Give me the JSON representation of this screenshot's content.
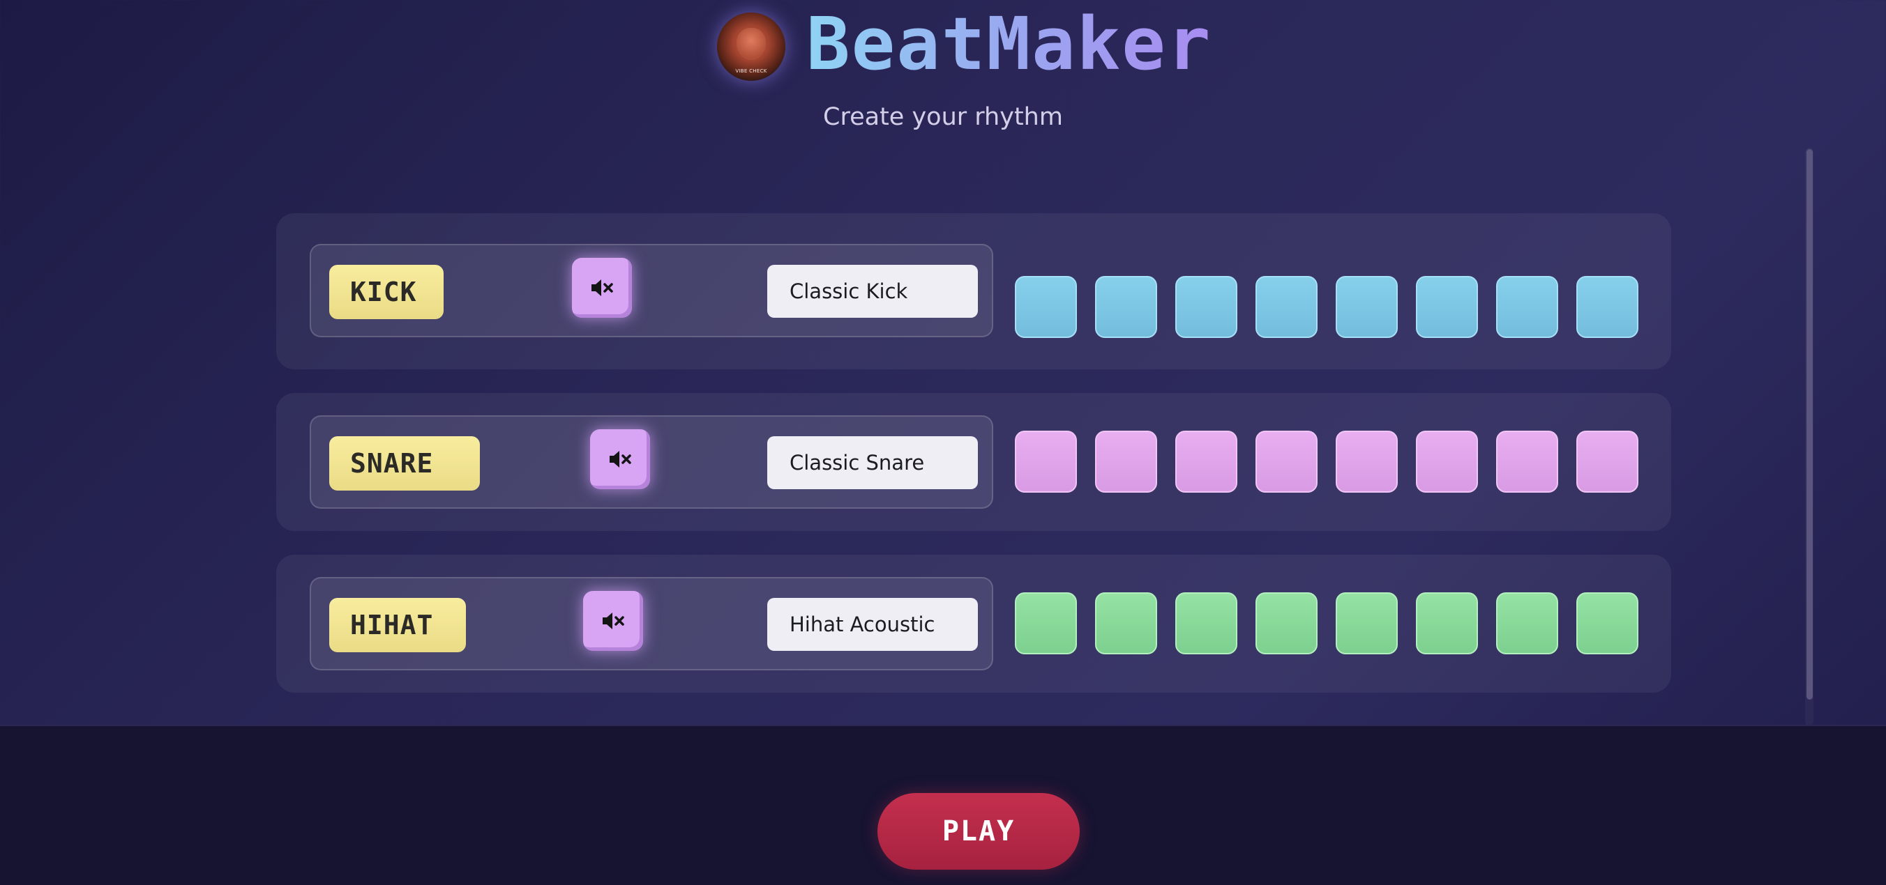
{
  "header": {
    "avatar_text": "VIBE CHECK",
    "title": "BeatMaker",
    "subtitle": "Create your rhythm"
  },
  "tracks": [
    {
      "label": "KICK",
      "sample": "Classic Kick",
      "mute_icon": "volume-mute-icon",
      "color": "#86d0ec",
      "steps_active": [
        false,
        false,
        false,
        false,
        false,
        false,
        false,
        false
      ]
    },
    {
      "label": "SNARE",
      "sample": "Classic Snare",
      "mute_icon": "volume-mute-icon",
      "color": "#e8aef0",
      "steps_active": [
        false,
        false,
        false,
        false,
        false,
        false,
        false,
        false
      ]
    },
    {
      "label": "HIHAT",
      "sample": "Hihat Acoustic",
      "mute_icon": "volume-mute-icon",
      "color": "#95e2a4",
      "steps_active": [
        false,
        false,
        false,
        false,
        false,
        false,
        false,
        false
      ]
    }
  ],
  "footer": {
    "play_label": "PLAY",
    "play_color": "#b7284a"
  },
  "theme": {
    "label_color": "#f3e596",
    "mute_color": "#d7a5f4"
  }
}
